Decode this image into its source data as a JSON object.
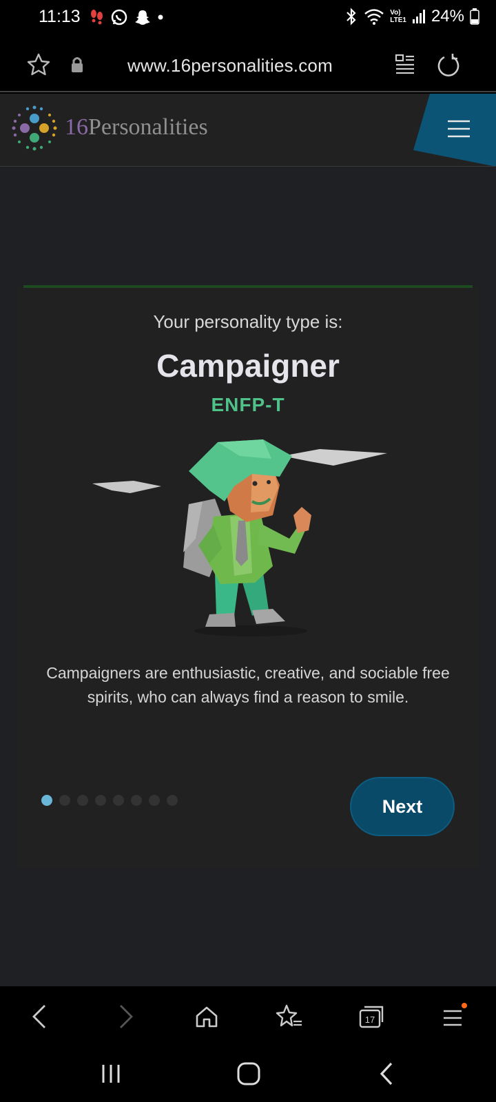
{
  "status_bar": {
    "time": "11:13",
    "battery": "24%",
    "network_label_top": "Vo)",
    "network_label_bottom": "LTE1"
  },
  "browser": {
    "url": "www.16personalities.com"
  },
  "site": {
    "brand_number": "16",
    "brand_name": "Personalities",
    "accent_color": "#0b5476"
  },
  "result": {
    "intro": "Your personality type is:",
    "type_name": "Campaigner",
    "type_code": "ENFP-T",
    "description": "Campaigners are enthusiastic, creative, and sociable free spirits, who can always find a reason to smile.",
    "next_label": "Next",
    "pagination": {
      "total": 8,
      "current": 1
    }
  },
  "toolbar": {
    "tab_count": "17",
    "icons": [
      "back-icon",
      "forward-icon",
      "home-icon",
      "bookmarks-icon",
      "tabs-icon",
      "menu-icon"
    ]
  },
  "system_nav": {
    "icons": [
      "recents-icon",
      "home-icon",
      "back-icon"
    ]
  }
}
